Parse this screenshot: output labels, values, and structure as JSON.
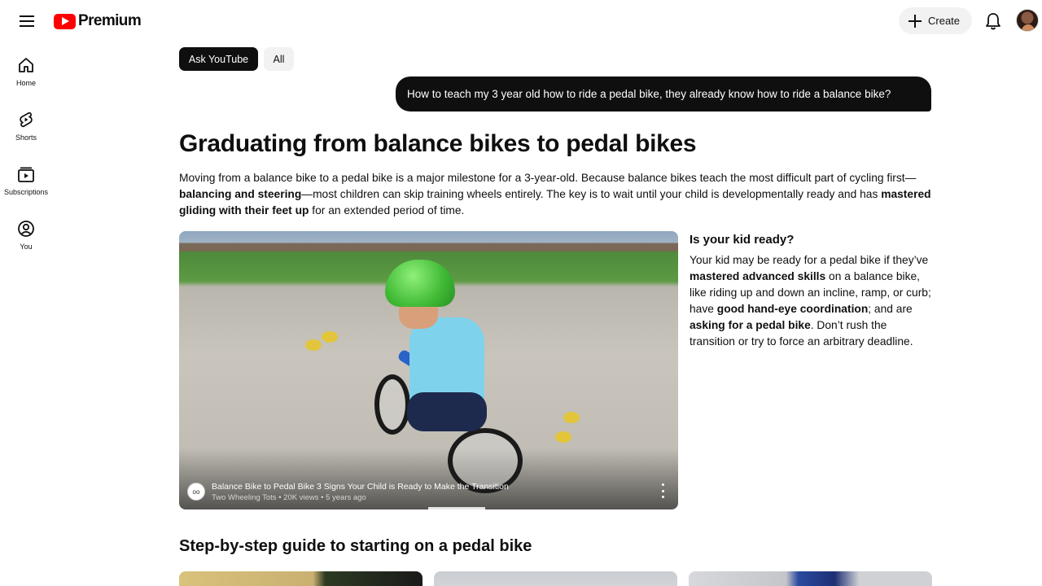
{
  "header": {
    "logo_text": "Premium",
    "create_label": "Create",
    "icons": {
      "menu": "hamburger-menu-icon",
      "logo": "youtube-play-icon",
      "create": "plus-icon",
      "notifications": "bell-icon"
    }
  },
  "sidebar": {
    "items": [
      {
        "label": "Home",
        "icon": "home-icon"
      },
      {
        "label": "Shorts",
        "icon": "shorts-icon"
      },
      {
        "label": "Subscriptions",
        "icon": "subscriptions-icon"
      },
      {
        "label": "You",
        "icon": "you-icon"
      }
    ]
  },
  "chips": [
    {
      "label": "Ask YouTube",
      "active": true
    },
    {
      "label": "All",
      "active": false
    }
  ],
  "query": "How to teach my 3 year old how to ride a pedal bike, they already know how to ride a balance bike?",
  "answer": {
    "title": "Graduating from balance bikes to pedal bikes",
    "intro": {
      "p1": "Moving from a balance bike to a pedal bike is a major milestone for a 3-year-old. Because balance bikes teach the most difficult part of cycling first—",
      "b1": "balancing and steering",
      "p2": "—most children can skip training wheels entirely. The key is to wait until your child is developmentally ready and has ",
      "b2": "mastered gliding with their feet up",
      "p3": " for an extended period of time."
    },
    "video": {
      "title": "Balance Bike to Pedal Bike 3 Signs Your Child is Ready to Make the Transition",
      "channel": "Two Wheeling Tots",
      "views": "20K views",
      "age": "5 years ago",
      "separator": "•"
    },
    "side": {
      "title": "Is your kid ready?",
      "t1": "Your kid may be ready for a pedal bike if they’ve ",
      "b1": "mastered advanced skills",
      "t2": " on a balance bike, like riding up and down an incline, ramp, or curb; have ",
      "b2": "good hand-eye coordination",
      "t3": "; and are ",
      "b3": "asking for a pedal bike",
      "t4": ". Don’t rush the transition or try to force an arbitrary deadline."
    },
    "steps_title": "Step-by-step guide to starting on a pedal bike"
  },
  "colors": {
    "brand_red": "#ff0000",
    "chip_active_bg": "#0f0f0f",
    "chip_bg": "#f2f2f2",
    "text": "#0f0f0f"
  }
}
